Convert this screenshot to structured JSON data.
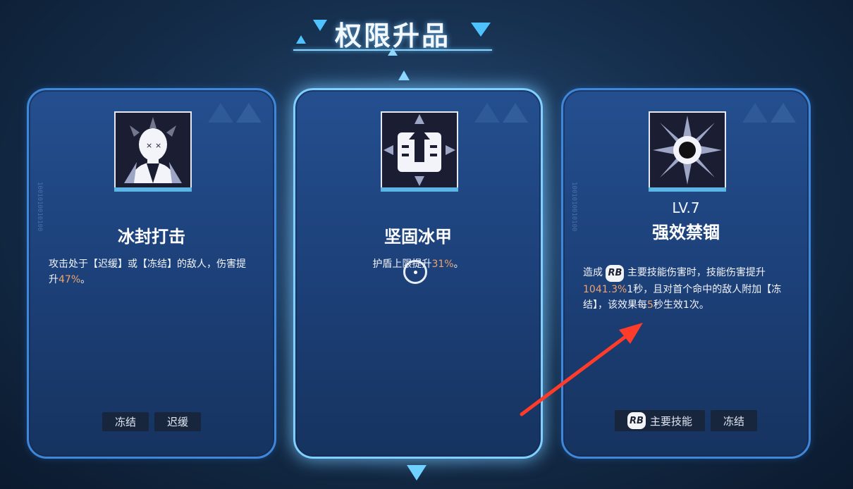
{
  "header": {
    "title": "权限升品"
  },
  "cards": [
    {
      "name": "冰封打击",
      "level": "",
      "icon": "frozen-skull-icon",
      "desc_parts": [
        "攻击处于【迟缓】或【冻结】的敌人，伤害提升",
        "47%",
        "。"
      ],
      "tags": [
        "冻结",
        "迟缓"
      ],
      "selected": false
    },
    {
      "name": "坚固冰甲",
      "level": "",
      "icon": "ice-armor-icon",
      "desc_parts": [
        "护盾上限提升",
        "31%",
        "。"
      ],
      "tags": [],
      "selected": true
    },
    {
      "name": "强效禁锢",
      "level": "LV.7",
      "icon": "frost-burst-icon",
      "desc_parts": [
        "造成",
        "主要技能伤害时，技能伤害提升",
        "1041.3%",
        "1秒，且对首个命中的敌人附加【冻结】，该效果每",
        "5",
        "秒生效1次。"
      ],
      "tags": [
        "主要技能",
        "冻结"
      ],
      "selected": false
    }
  ],
  "rb_label": "RB",
  "colors": {
    "highlight": "#f0a36b",
    "accent": "#4ec1ff",
    "arrow": "#ff3b2a"
  }
}
